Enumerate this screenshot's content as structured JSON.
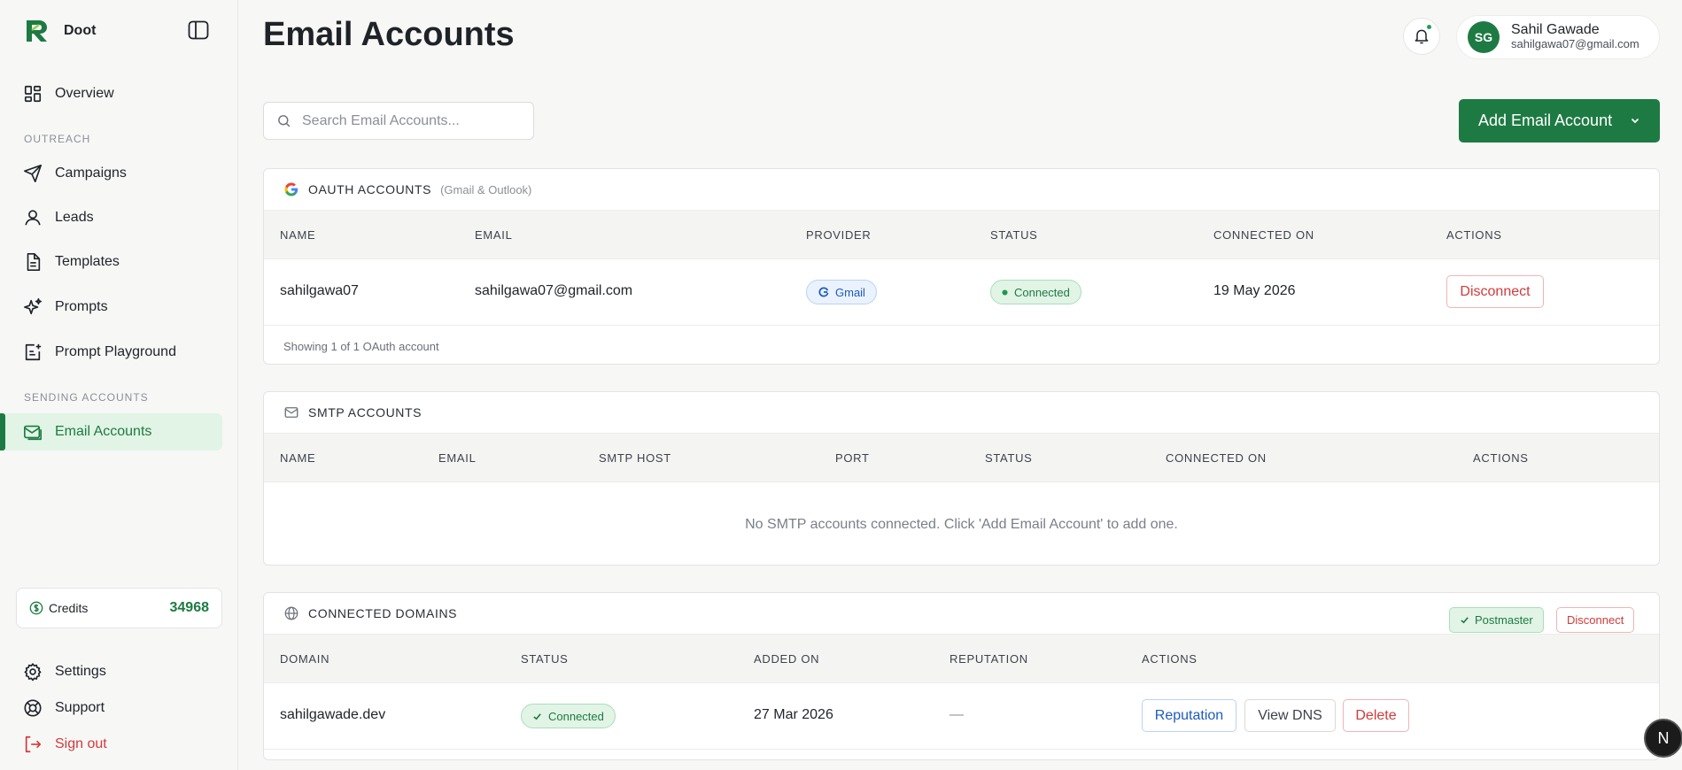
{
  "app": {
    "name": "Doot",
    "accent": "#1e7a43"
  },
  "sidebar": {
    "overview": "Overview",
    "outreach_label": "OUTREACH",
    "items": [
      {
        "label": "Campaigns",
        "icon": "send-icon"
      },
      {
        "label": "Leads",
        "icon": "user-icon"
      },
      {
        "label": "Templates",
        "icon": "document-icon"
      },
      {
        "label": "Prompts",
        "icon": "sparkles-icon"
      },
      {
        "label": "Prompt Playground",
        "icon": "playground-icon"
      }
    ],
    "sending_label": "SENDING ACCOUNTS",
    "email_accounts": "Email Accounts",
    "credits_label": "Credits",
    "credits_value": "34968",
    "settings": "Settings",
    "support": "Support",
    "signout": "Sign out"
  },
  "header": {
    "title": "Email Accounts",
    "user_initials": "SG",
    "user_name": "Sahil Gawade",
    "user_email": "sahilgawa07@gmail.com"
  },
  "toolbar": {
    "search_placeholder": "Search Email Accounts...",
    "add_label": "Add Email Account"
  },
  "oauth": {
    "title": "OAUTH ACCOUNTS",
    "subtitle": "(Gmail & Outlook)",
    "columns": [
      "NAME",
      "EMAIL",
      "PROVIDER",
      "STATUS",
      "CONNECTED ON",
      "ACTIONS"
    ],
    "row": {
      "name": "sahilgawa07",
      "email": "sahilgawa07@gmail.com",
      "provider": "Gmail",
      "status": "Connected",
      "connected_on": "19 May 2026",
      "action": "Disconnect"
    },
    "footer": "Showing 1 of 1 OAuth account"
  },
  "smtp": {
    "title": "SMTP ACCOUNTS",
    "columns": [
      "NAME",
      "EMAIL",
      "SMTP HOST",
      "PORT",
      "STATUS",
      "CONNECTED ON",
      "ACTIONS"
    ],
    "empty": "No SMTP accounts connected. Click 'Add Email Account' to add one."
  },
  "domains": {
    "title": "CONNECTED DOMAINS",
    "postmaster": "Postmaster",
    "disconnect": "Disconnect",
    "columns": [
      "DOMAIN",
      "STATUS",
      "ADDED ON",
      "REPUTATION",
      "ACTIONS"
    ],
    "row": {
      "domain": "sahilgawade.dev",
      "status": "Connected",
      "added_on": "27 Mar 2026",
      "reputation": "—",
      "actions": [
        "Reputation",
        "View DNS",
        "Delete"
      ]
    }
  },
  "fab": {
    "label": "N"
  }
}
